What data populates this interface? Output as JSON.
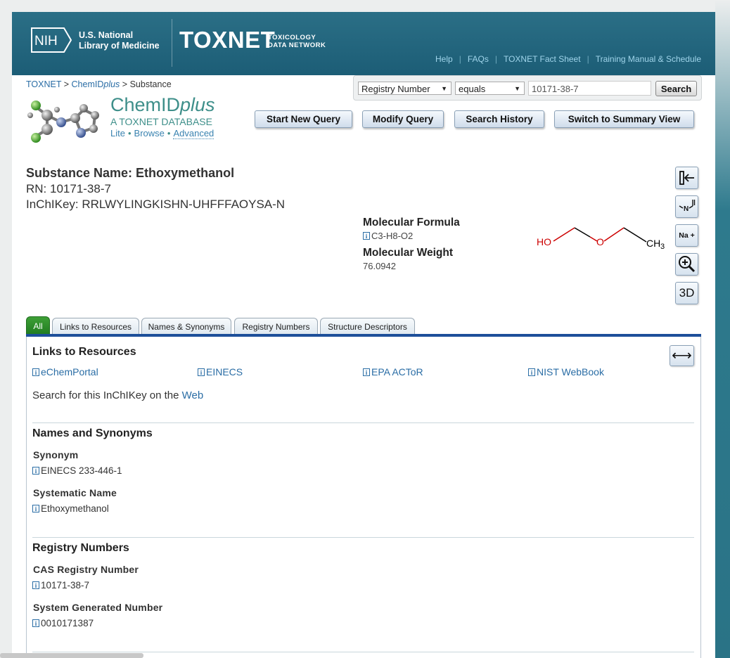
{
  "banner": {
    "nih_logo": "NIH",
    "nlm_line1": "U.S. National",
    "nlm_line2": "Library of Medicine",
    "toxnet": "TOXNET",
    "toxnet_sub1": "TOXICOLOGY",
    "toxnet_sub2": "DATA NETWORK",
    "links": [
      "Help",
      "FAQs",
      "TOXNET Fact Sheet",
      "Training Manual & Schedule"
    ]
  },
  "breadcrumb": {
    "item1": "TOXNET",
    "item2a": "ChemID",
    "item2b": "plus",
    "current": "Substance",
    "sep": ">"
  },
  "search": {
    "field_select": "Registry Number",
    "op_select": "equals",
    "query": "10171-38-7",
    "button": "Search"
  },
  "chemid": {
    "title_a": "ChemID",
    "title_b": "plus",
    "subtitle": "A TOXNET DATABASE",
    "link_lite": "Lite",
    "link_browse": "Browse",
    "link_advanced": "Advanced"
  },
  "query_buttons": [
    "Start New Query",
    "Modify Query",
    "Search History",
    "Switch to Summary View"
  ],
  "substance": {
    "name_line": "Substance Name: Ethoxymethanol",
    "rn_line": "RN: 10171-38-7",
    "inchikey_line": "InChIKey: RRLWYLINGKISHN-UHFFFAOYSA-N"
  },
  "properties": {
    "mf_label": "Molecular Formula",
    "mf_value": "C3-H8-O2",
    "mw_label": "Molecular Weight",
    "mw_value": "76.0942"
  },
  "structure": {
    "ho": "HO",
    "o": "O",
    "ch3": "CH",
    "sub3": "3"
  },
  "side_buttons": {
    "na_label": "Na +",
    "three_d": "3D"
  },
  "tabs": [
    "All",
    "Links to Resources",
    "Names & Synonyms",
    "Registry Numbers",
    "Structure Descriptors"
  ],
  "links_section": {
    "heading": "Links to Resources",
    "resources": [
      "eChemPortal",
      "EINECS",
      "EPA ACToR",
      "NIST WebBook"
    ],
    "web_text": "Search for this InChIKey on the",
    "web_link": "Web",
    "swap": "⟷"
  },
  "names_section": {
    "heading": "Names and Synonyms",
    "synonym_label": "Synonym",
    "synonym_value": "EINECS 233-446-1",
    "systematic_label": "Systematic Name",
    "systematic_value": "Ethoxymethanol"
  },
  "registry_section": {
    "heading": "Registry Numbers",
    "cas_label": "CAS Registry Number",
    "cas_value": "10171-38-7",
    "sys_label": "System Generated Number",
    "sys_value": "0010171387"
  },
  "info_icon": "i",
  "colors": {
    "banner": "#1c5d76",
    "link": "#2a6da5",
    "brand_teal": "#3e8f8a",
    "tab_active": "#2e8b2e",
    "tab_rule": "#1d4f9a"
  }
}
